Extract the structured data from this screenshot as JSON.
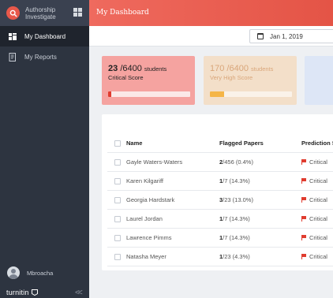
{
  "brand": {
    "line1": "Authorship",
    "line2": "Investigate"
  },
  "sidebar": {
    "items": [
      {
        "label": "My Dashboard",
        "icon": "dashboard-icon",
        "active": true
      },
      {
        "label": "My Reports",
        "icon": "reports-icon",
        "active": false
      }
    ],
    "user": "Mbroacha",
    "footer_brand": "turnitin",
    "collapse_label": "<<"
  },
  "header": {
    "title": "My Dashboard"
  },
  "toolbar": {
    "date": "Jan 1, 2019"
  },
  "cards": [
    {
      "count": "23",
      "total": "/6400",
      "unit": "students",
      "label": "Critical Score",
      "progress_fraction": 0.04
    },
    {
      "count": "170",
      "total": "/6400",
      "unit": "students",
      "label": "Very High Score",
      "progress_fraction": 0.17
    }
  ],
  "table": {
    "headers": {
      "name": "Name",
      "flagged": "Flagged Papers",
      "prediction": "Prediction S"
    },
    "rows": [
      {
        "name": "Gayle Waters-Waters",
        "flag_count": "2",
        "flag_rest": "/456 (0.4%)",
        "prediction": "Critical"
      },
      {
        "name": "Karen Kilgariff",
        "flag_count": "1",
        "flag_rest": "/7 (14.3%)",
        "prediction": "Critical"
      },
      {
        "name": "Georgia Hardstark",
        "flag_count": "3",
        "flag_rest": "/23 (13.0%)",
        "prediction": "Critical"
      },
      {
        "name": "Laurel Jordan",
        "flag_count": "1",
        "flag_rest": "/7 (14.3%)",
        "prediction": "Critical"
      },
      {
        "name": "Lawrence Pimms",
        "flag_count": "1",
        "flag_rest": "/7 (14.3%)",
        "prediction": "Critical"
      },
      {
        "name": "Natasha Meyer",
        "flag_count": "1",
        "flag_rest": "/23 (4.3%)",
        "prediction": "Critical"
      }
    ]
  },
  "colors": {
    "accent": "#e8584a",
    "sidebar": "#2d3440",
    "critical": "#e03c2f",
    "warning": "#f5b547"
  }
}
